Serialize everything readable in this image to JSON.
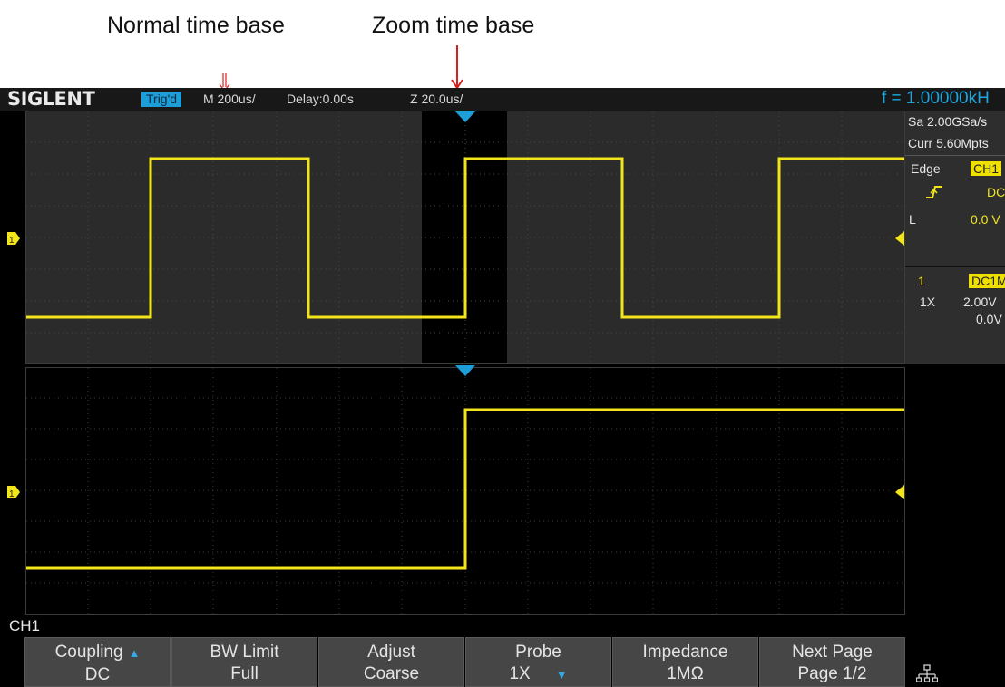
{
  "annotations": {
    "normal_label": "Normal time base",
    "zoom_label": "Zoom time base"
  },
  "topbar": {
    "brand": "SIGLENT",
    "trigger_status": "Trig'd",
    "main_timebase": "M 200us/",
    "delay": "Delay:0.00s",
    "zoom_timebase": "Z 20.0us/",
    "frequency": "f = 1.00000kH"
  },
  "side_panel": {
    "sample_rate": "Sa 2.00GSa/s",
    "memory_depth": "Curr 5.60Mpts",
    "trigger_type": "Edge",
    "trigger_source": "CH1",
    "trigger_coupling": "DC",
    "trigger_level_label": "L",
    "trigger_level": "0.0 V",
    "channel_number": "1",
    "channel_coupling": "DC1M",
    "probe_ratio": "1X",
    "vertical_scale": "2.00V",
    "vertical_offset": "0.0V"
  },
  "channel_marker": "1",
  "channel_label": "CH1",
  "softkeys": [
    {
      "line1": "Coupling",
      "line2": "DC",
      "arrow": true
    },
    {
      "line1": "BW Limit",
      "line2": "Full",
      "arrow": false
    },
    {
      "line1": "Adjust",
      "line2": "Coarse",
      "arrow": false
    },
    {
      "line1": "Probe",
      "line2": "1X",
      "arrow": true
    },
    {
      "line1": "Impedance",
      "line2": "1MΩ",
      "arrow": false
    },
    {
      "line1": "Next Page",
      "line2": "Page 1/2",
      "arrow": false
    }
  ],
  "colors": {
    "trace": "#f2e61a",
    "accent": "#1e9ed8",
    "annotation_arrow": "#d42020"
  },
  "icons": {
    "network": "network-icon",
    "trigger_edge": "rising-edge-icon"
  }
}
